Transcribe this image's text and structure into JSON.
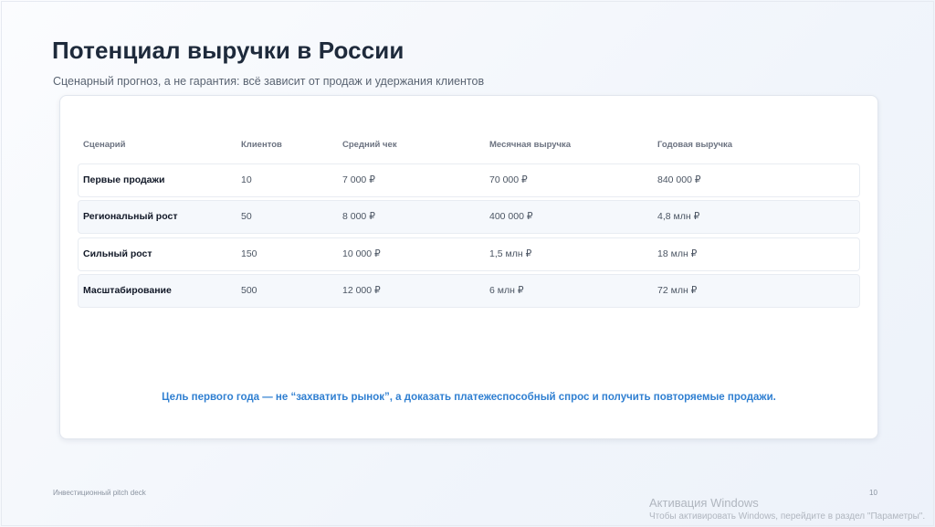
{
  "slide": {
    "title": "Потенциал выручки в России",
    "subtitle": "Сценарный прогноз, а не гарантия: всё зависит от продаж и удержания клиентов",
    "table": {
      "headers": [
        "Сценарий",
        "Клиентов",
        "Средний чек",
        "Месячная выручка",
        "Годовая выручка"
      ],
      "rows": [
        [
          "Первые продажи",
          "10",
          "7 000 ₽",
          "70 000 ₽",
          "840 000 ₽"
        ],
        [
          "Региональный рост",
          "50",
          "8 000 ₽",
          "400 000 ₽",
          "4,8 млн ₽"
        ],
        [
          "Сильный рост",
          "150",
          "10 000 ₽",
          "1,5 млн ₽",
          "18 млн ₽"
        ],
        [
          "Масштабирование",
          "500",
          "12 000 ₽",
          "6 млн ₽",
          "72 млн ₽"
        ]
      ]
    },
    "callout": "Цель первого года — не “захватить рынок”, а доказать платежеспособный спрос и получить повторяемые продажи.",
    "footer_left": "Инвестиционный pitch deck",
    "page_number": "10"
  },
  "watermark": {
    "title": "Активация Windows",
    "subtitle": "Чтобы активировать Windows, перейдите в раздел \"Параметры\"."
  },
  "colors": {
    "title": "#1e2a3b",
    "accent": "#2f7fd1",
    "card_bg": "#ffffff",
    "row_alt_bg": "#f5f8fc"
  }
}
